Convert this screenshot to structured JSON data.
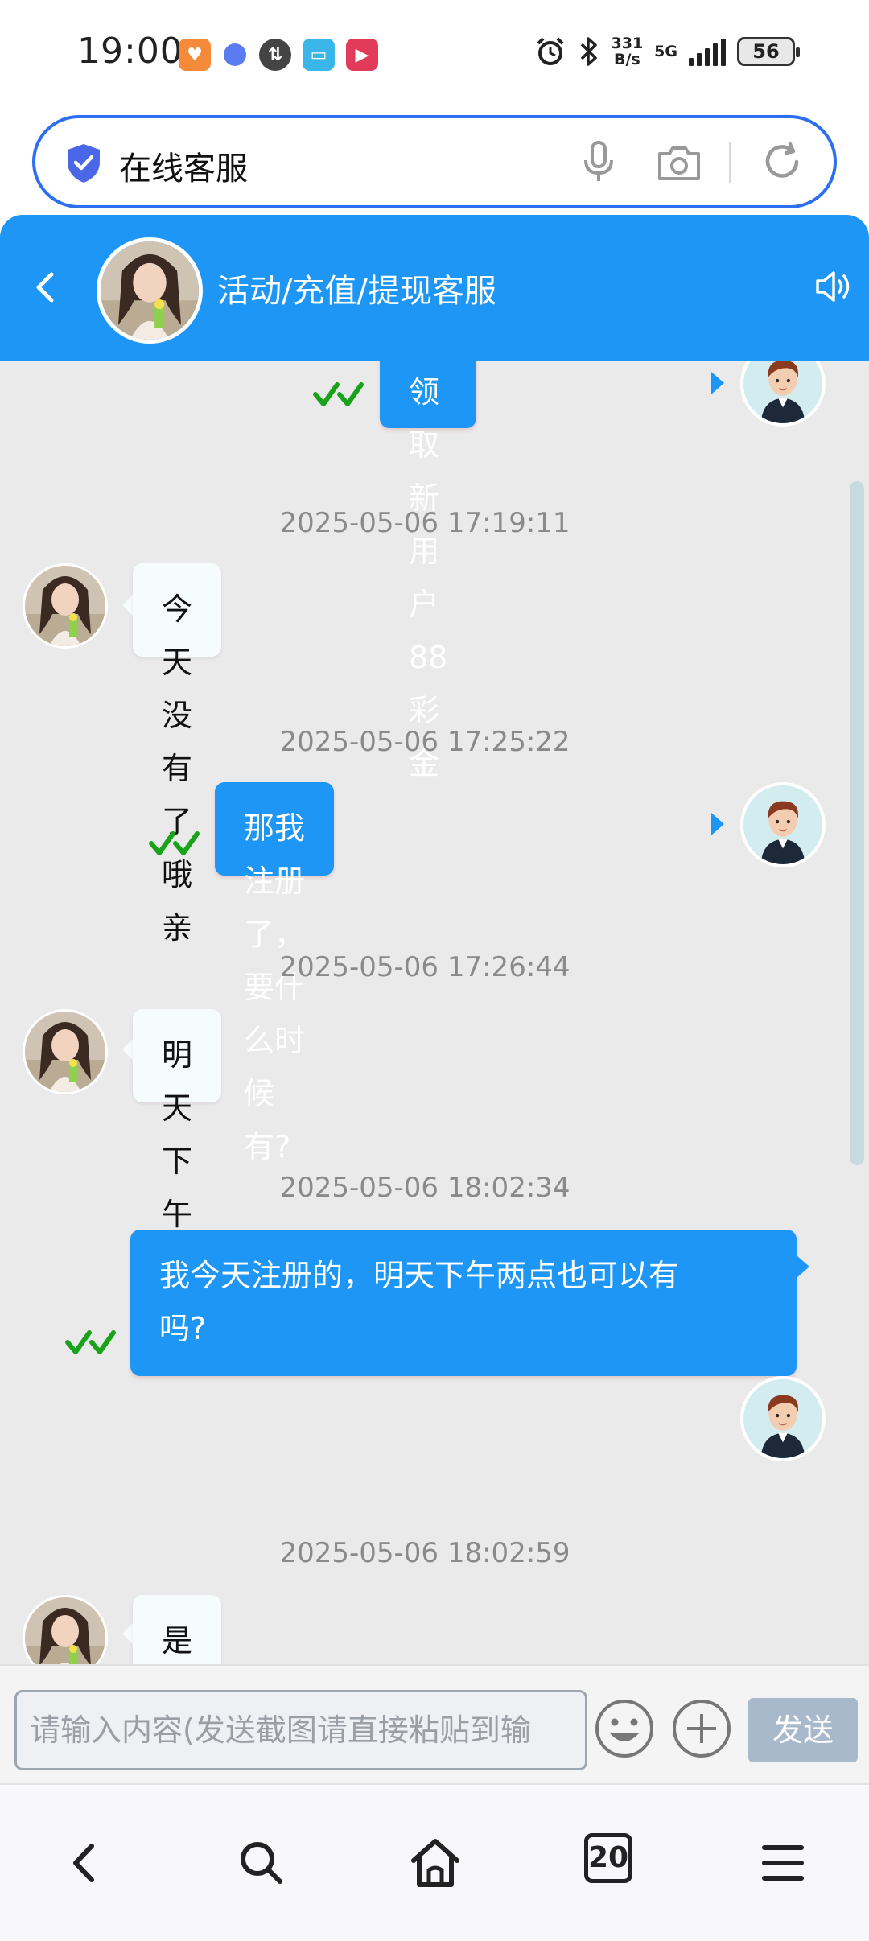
{
  "status_bar": {
    "time": "19:00",
    "net_speed_top": "331",
    "net_speed_bottom": "B/s",
    "network_type": "5G",
    "battery": "56",
    "app_icons": [
      "heart-app-icon",
      "ball-app-icon",
      "sync-app-icon",
      "book-app-icon",
      "video-app-icon"
    ],
    "system_icons": [
      "alarm-icon",
      "bluetooth-icon",
      "signal-icon",
      "battery-icon"
    ]
  },
  "search": {
    "text": "在线客服",
    "icons": [
      "shield-icon",
      "microphone-icon",
      "camera-icon",
      "refresh-icon"
    ]
  },
  "header": {
    "title": "活动/充值/提现客服",
    "icons": [
      "back-icon",
      "speaker-icon"
    ]
  },
  "messages": [
    {
      "direction": "out",
      "text": "领取新用户88彩金",
      "read": true
    },
    {
      "timestamp": "2025-05-06 17:19:11",
      "direction": "in",
      "text": "今天没有了哦亲"
    },
    {
      "timestamp": "2025-05-06 17:25:22",
      "direction": "out",
      "text": "那我注册了，要什么时候有?",
      "read": true
    },
    {
      "timestamp": "2025-05-06 17:26:44",
      "direction": "in",
      "text": "明天下午两点"
    },
    {
      "timestamp": "2025-05-06 18:02:34",
      "direction": "out",
      "text_line1": "我今天注册的，明天下午两点也可以有",
      "text_line2": "吗?",
      "read": true
    },
    {
      "timestamp": "2025-05-06 18:02:59",
      "direction": "in",
      "text": "是的亲"
    }
  ],
  "input": {
    "placeholder": "请输入内容(发送截图请直接粘贴到输",
    "send_label": "发送",
    "icons": [
      "emoji-icon",
      "plus-icon"
    ]
  },
  "bottom_nav": {
    "tab_count": "20",
    "icons": [
      "back-icon",
      "search-icon",
      "home-icon",
      "tabs-icon",
      "menu-icon"
    ]
  },
  "colors": {
    "accent": "#1e96f5",
    "chat_background": "#ebeaeb",
    "incoming_bubble": "#f5fcfb",
    "read_tick": "#1aa31a",
    "search_border": "#2d6ff0"
  }
}
